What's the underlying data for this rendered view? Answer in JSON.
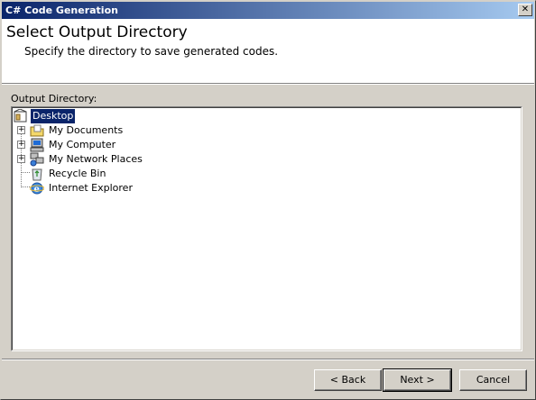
{
  "window": {
    "title": "C# Code Generation",
    "close_glyph": "✕"
  },
  "header": {
    "title": "Select Output Directory",
    "description": "Specify the directory to save generated codes."
  },
  "output": {
    "label": "Output Directory:",
    "tree": [
      {
        "label": "Desktop",
        "icon": "desktop-icon",
        "selected": true
      },
      {
        "label": "My Documents",
        "icon": "folder-documents-icon",
        "expandable": true
      },
      {
        "label": "My Computer",
        "icon": "computer-icon",
        "expandable": true
      },
      {
        "label": "My Network Places",
        "icon": "network-places-icon",
        "expandable": true
      },
      {
        "label": "Recycle Bin",
        "icon": "recycle-bin-icon"
      },
      {
        "label": "Internet Explorer",
        "icon": "internet-explorer-icon"
      }
    ]
  },
  "buttons": {
    "back": "< Back",
    "next": "Next >",
    "cancel": "Cancel"
  },
  "colors": {
    "title_start": "#0a246a",
    "title_end": "#a6caf0",
    "selection": "#0a246a",
    "face": "#d4d0c8"
  }
}
